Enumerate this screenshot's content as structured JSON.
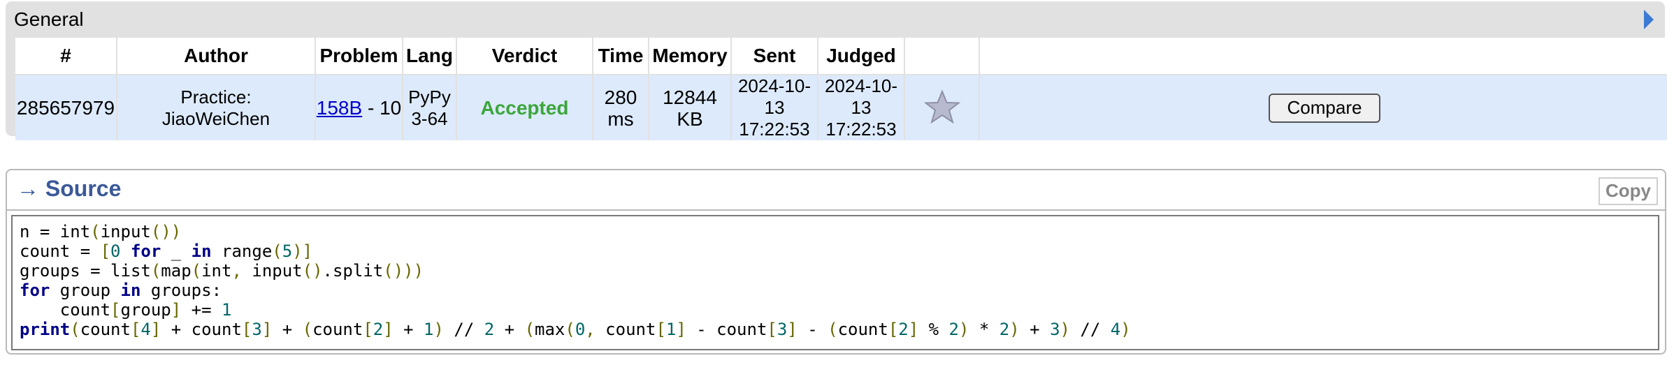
{
  "general": {
    "title": "General",
    "table": {
      "headers": [
        "#",
        "Author",
        "Problem",
        "Lang",
        "Verdict",
        "Time",
        "Memory",
        "Sent",
        "Judged",
        "",
        ""
      ],
      "row": {
        "id": "285657979",
        "author_line1": "Practice:",
        "author_line2": "JiaoWeiChen",
        "problem_link": "158B",
        "problem_suffix": " - 10",
        "lang_line1": "PyPy",
        "lang_line2": "3-64",
        "verdict": "Accepted",
        "time": "280 ms",
        "memory": "12844 KB",
        "sent_date": "2024-10-13",
        "sent_time": "17:22:53",
        "judged_date": "2024-10-13",
        "judged_time": "17:22:53",
        "compare_label": "Compare"
      }
    },
    "icons": {
      "play": "play-icon",
      "favorite": "star-icon"
    },
    "colors": {
      "verdict": "#3ba63b",
      "row_bg": "#ddeafc",
      "link": "#0000cc"
    }
  },
  "source": {
    "title": "→ Source",
    "copy_label": "Copy",
    "code": [
      "n = int(input())",
      "count = [0 for _ in range(5)]",
      "groups = list(map(int, input().split()))",
      "for group in groups:",
      "    count[group] += 1",
      "print(count[4] + count[3] + (count[2] + 1) // 2 + (max(0, count[1] - count[3] - (count[2] % 2) * 2) + 3) // 4)"
    ]
  }
}
